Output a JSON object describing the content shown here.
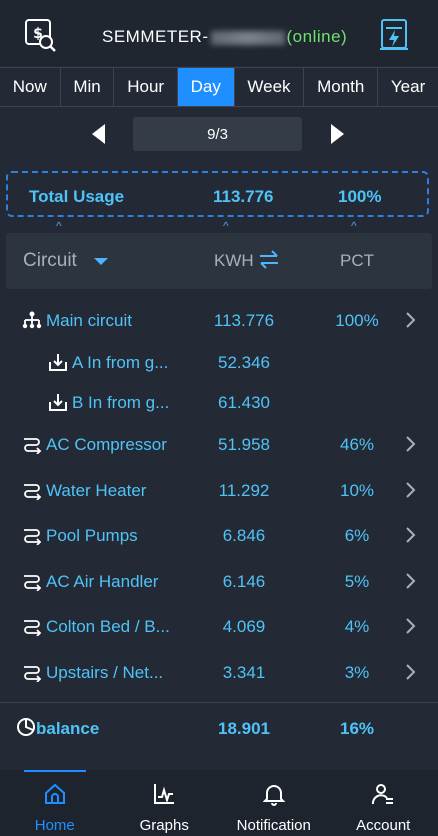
{
  "header": {
    "title_prefix": "SEMMETER-",
    "status": "(online)"
  },
  "tabs": [
    {
      "label": "Now"
    },
    {
      "label": "Min"
    },
    {
      "label": "Hour"
    },
    {
      "label": "Day",
      "active": true
    },
    {
      "label": "Week"
    },
    {
      "label": "Month"
    },
    {
      "label": "Year"
    }
  ],
  "date_nav": {
    "date": "9/3"
  },
  "total": {
    "label": "Total Usage",
    "kwh": "113.776",
    "pct": "100%"
  },
  "columns": {
    "circuit": "Circuit",
    "kwh": "KWH",
    "pct": "PCT"
  },
  "rows": [
    {
      "icon": "tree-icon",
      "name": "Main circuit",
      "kwh": "113.776",
      "pct": "100%",
      "chevron": true
    },
    {
      "icon": "import-icon",
      "name": "A In from g...",
      "kwh": "52.346",
      "pct": "",
      "chevron": false
    },
    {
      "icon": "import-icon",
      "name": "B In from g...",
      "kwh": "61.430",
      "pct": "",
      "chevron": false
    },
    {
      "icon": "circuit-icon",
      "name": "AC Compressor",
      "kwh": "51.958",
      "pct": "46%",
      "chevron": true
    },
    {
      "icon": "circuit-icon",
      "name": "Water Heater",
      "kwh": "11.292",
      "pct": "10%",
      "chevron": true
    },
    {
      "icon": "circuit-icon",
      "name": "Pool Pumps",
      "kwh": "6.846",
      "pct": "6%",
      "chevron": true
    },
    {
      "icon": "circuit-icon",
      "name": "AC Air Handler",
      "kwh": "6.146",
      "pct": "5%",
      "chevron": true
    },
    {
      "icon": "circuit-icon",
      "name": "Colton Bed / B...",
      "kwh": "4.069",
      "pct": "4%",
      "chevron": true
    },
    {
      "icon": "circuit-icon",
      "name": "Upstairs / Net...",
      "kwh": "3.341",
      "pct": "3%",
      "chevron": true
    }
  ],
  "balance": {
    "icon": "pie-icon",
    "name": "balance",
    "kwh": "18.901",
    "pct": "16%"
  },
  "bottom_nav": [
    {
      "icon": "home-icon",
      "label": "Home",
      "active": true
    },
    {
      "icon": "graph-icon",
      "label": "Graphs"
    },
    {
      "icon": "bell-icon",
      "label": "Notification"
    },
    {
      "icon": "account-icon",
      "label": "Account"
    }
  ],
  "colors": {
    "accent": "#1f8fff",
    "value": "#4fc3f7",
    "online": "#6fe06f",
    "background": "#232a35"
  }
}
